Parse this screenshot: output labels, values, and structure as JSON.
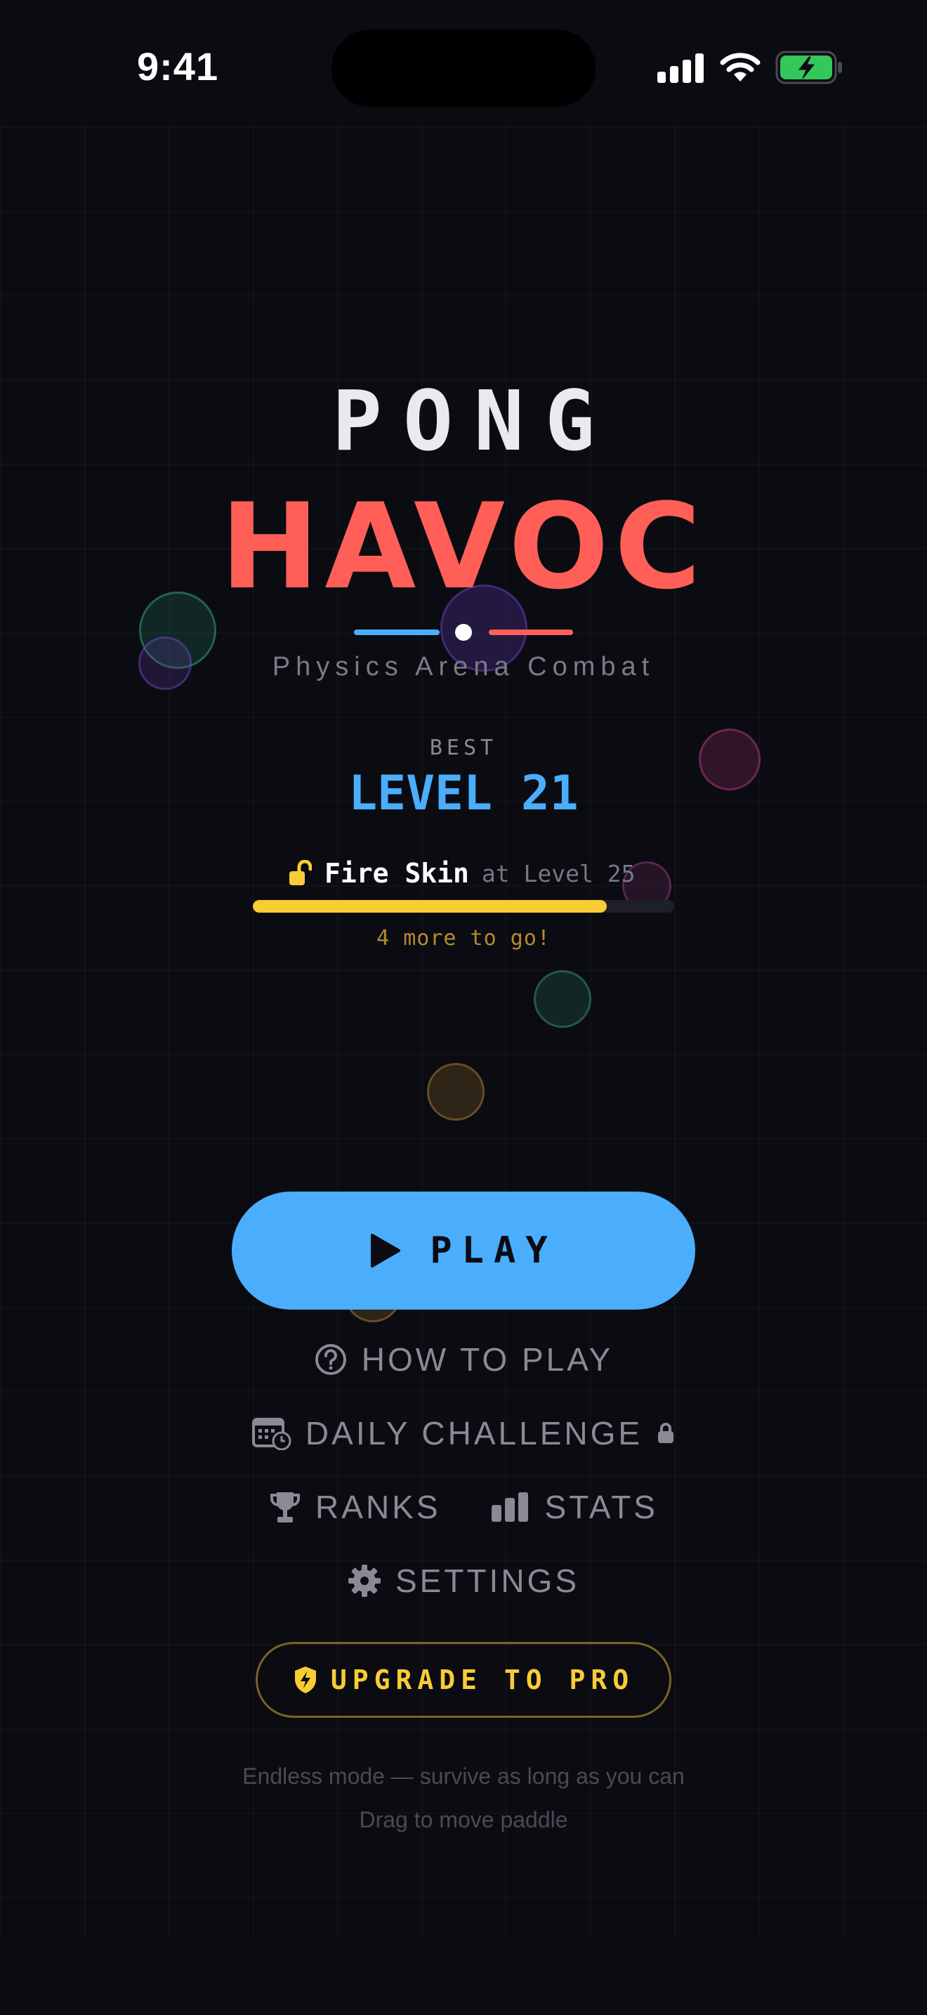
{
  "status_bar": {
    "time": "9:41"
  },
  "title": {
    "top": "PONG",
    "main": "HAVOC",
    "tagline": "Physics Arena Combat"
  },
  "best": {
    "label": "BEST",
    "value": "LEVEL 21"
  },
  "unlock": {
    "name": "Fire Skin",
    "level_text": "at Level 25",
    "progress": 0.84,
    "remaining_text": "4 more to go!"
  },
  "menu": {
    "play": "PLAY",
    "how_to_play": "HOW TO PLAY",
    "daily_challenge": "DAILY CHALLENGE",
    "ranks": "RANKS",
    "stats": "STATS",
    "settings": "SETTINGS",
    "upgrade": "UPGRADE TO PRO"
  },
  "footer": {
    "line1": "Endless mode — survive as long as you can",
    "line2": "Drag to move paddle"
  },
  "colors": {
    "background": "#0b0b12",
    "accent_blue": "#4aaefc",
    "accent_red": "#ff5f57",
    "accent_yellow": "#f9cc35",
    "muted": "#8a8a96"
  },
  "icons": [
    "cellular-signal-icon",
    "wifi-icon",
    "battery-charging-icon",
    "unlock-icon",
    "play-icon",
    "help-circle-icon",
    "calendar-clock-icon",
    "lock-icon",
    "trophy-icon",
    "bar-chart-icon",
    "gear-icon",
    "shield-bolt-icon"
  ]
}
